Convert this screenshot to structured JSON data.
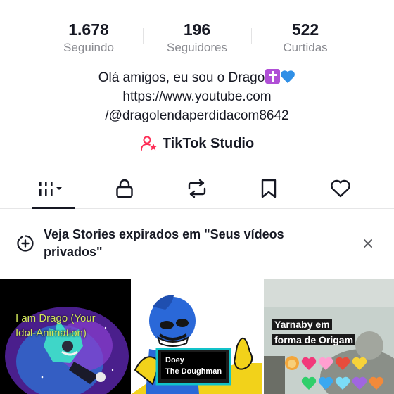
{
  "stats": [
    {
      "value": "1.678",
      "label": "Seguindo"
    },
    {
      "value": "196",
      "label": "Seguidores"
    },
    {
      "value": "522",
      "label": "Curtidas"
    }
  ],
  "bio": {
    "line1": "Olá amigos, eu sou o Drago",
    "line1_emojis": [
      "cross-emoji",
      "blue-heart-emoji"
    ],
    "line2": "https://www.youtube.com",
    "line3": "/@dragolendaperdidacom8642"
  },
  "studio": {
    "label": "TikTok Studio",
    "icon": "user-star-icon"
  },
  "tabs": [
    {
      "name": "videos",
      "icon": "grid-icon",
      "active": true
    },
    {
      "name": "private",
      "icon": "lock-icon",
      "active": false
    },
    {
      "name": "reposts",
      "icon": "repost-icon",
      "active": false
    },
    {
      "name": "favorites",
      "icon": "bookmark-icon",
      "active": false
    },
    {
      "name": "liked",
      "icon": "heart-icon",
      "active": false
    }
  ],
  "banner": {
    "text": "Veja Stories expirados em \"Seus vídeos privados\"",
    "icon": "story-plus-icon",
    "close_icon": "close-icon"
  },
  "videos": [
    {
      "caption": "I am Drago (Your Idol-Animation)"
    },
    {
      "caption_line1": "Doey",
      "caption_line2": "The Doughman"
    },
    {
      "caption_line1": "Yarnaby em",
      "caption_line2": "forma de Origam"
    }
  ],
  "colors": {
    "text": "#161823",
    "muted": "#8a8b91",
    "studio_accent": "#fe2c55"
  }
}
